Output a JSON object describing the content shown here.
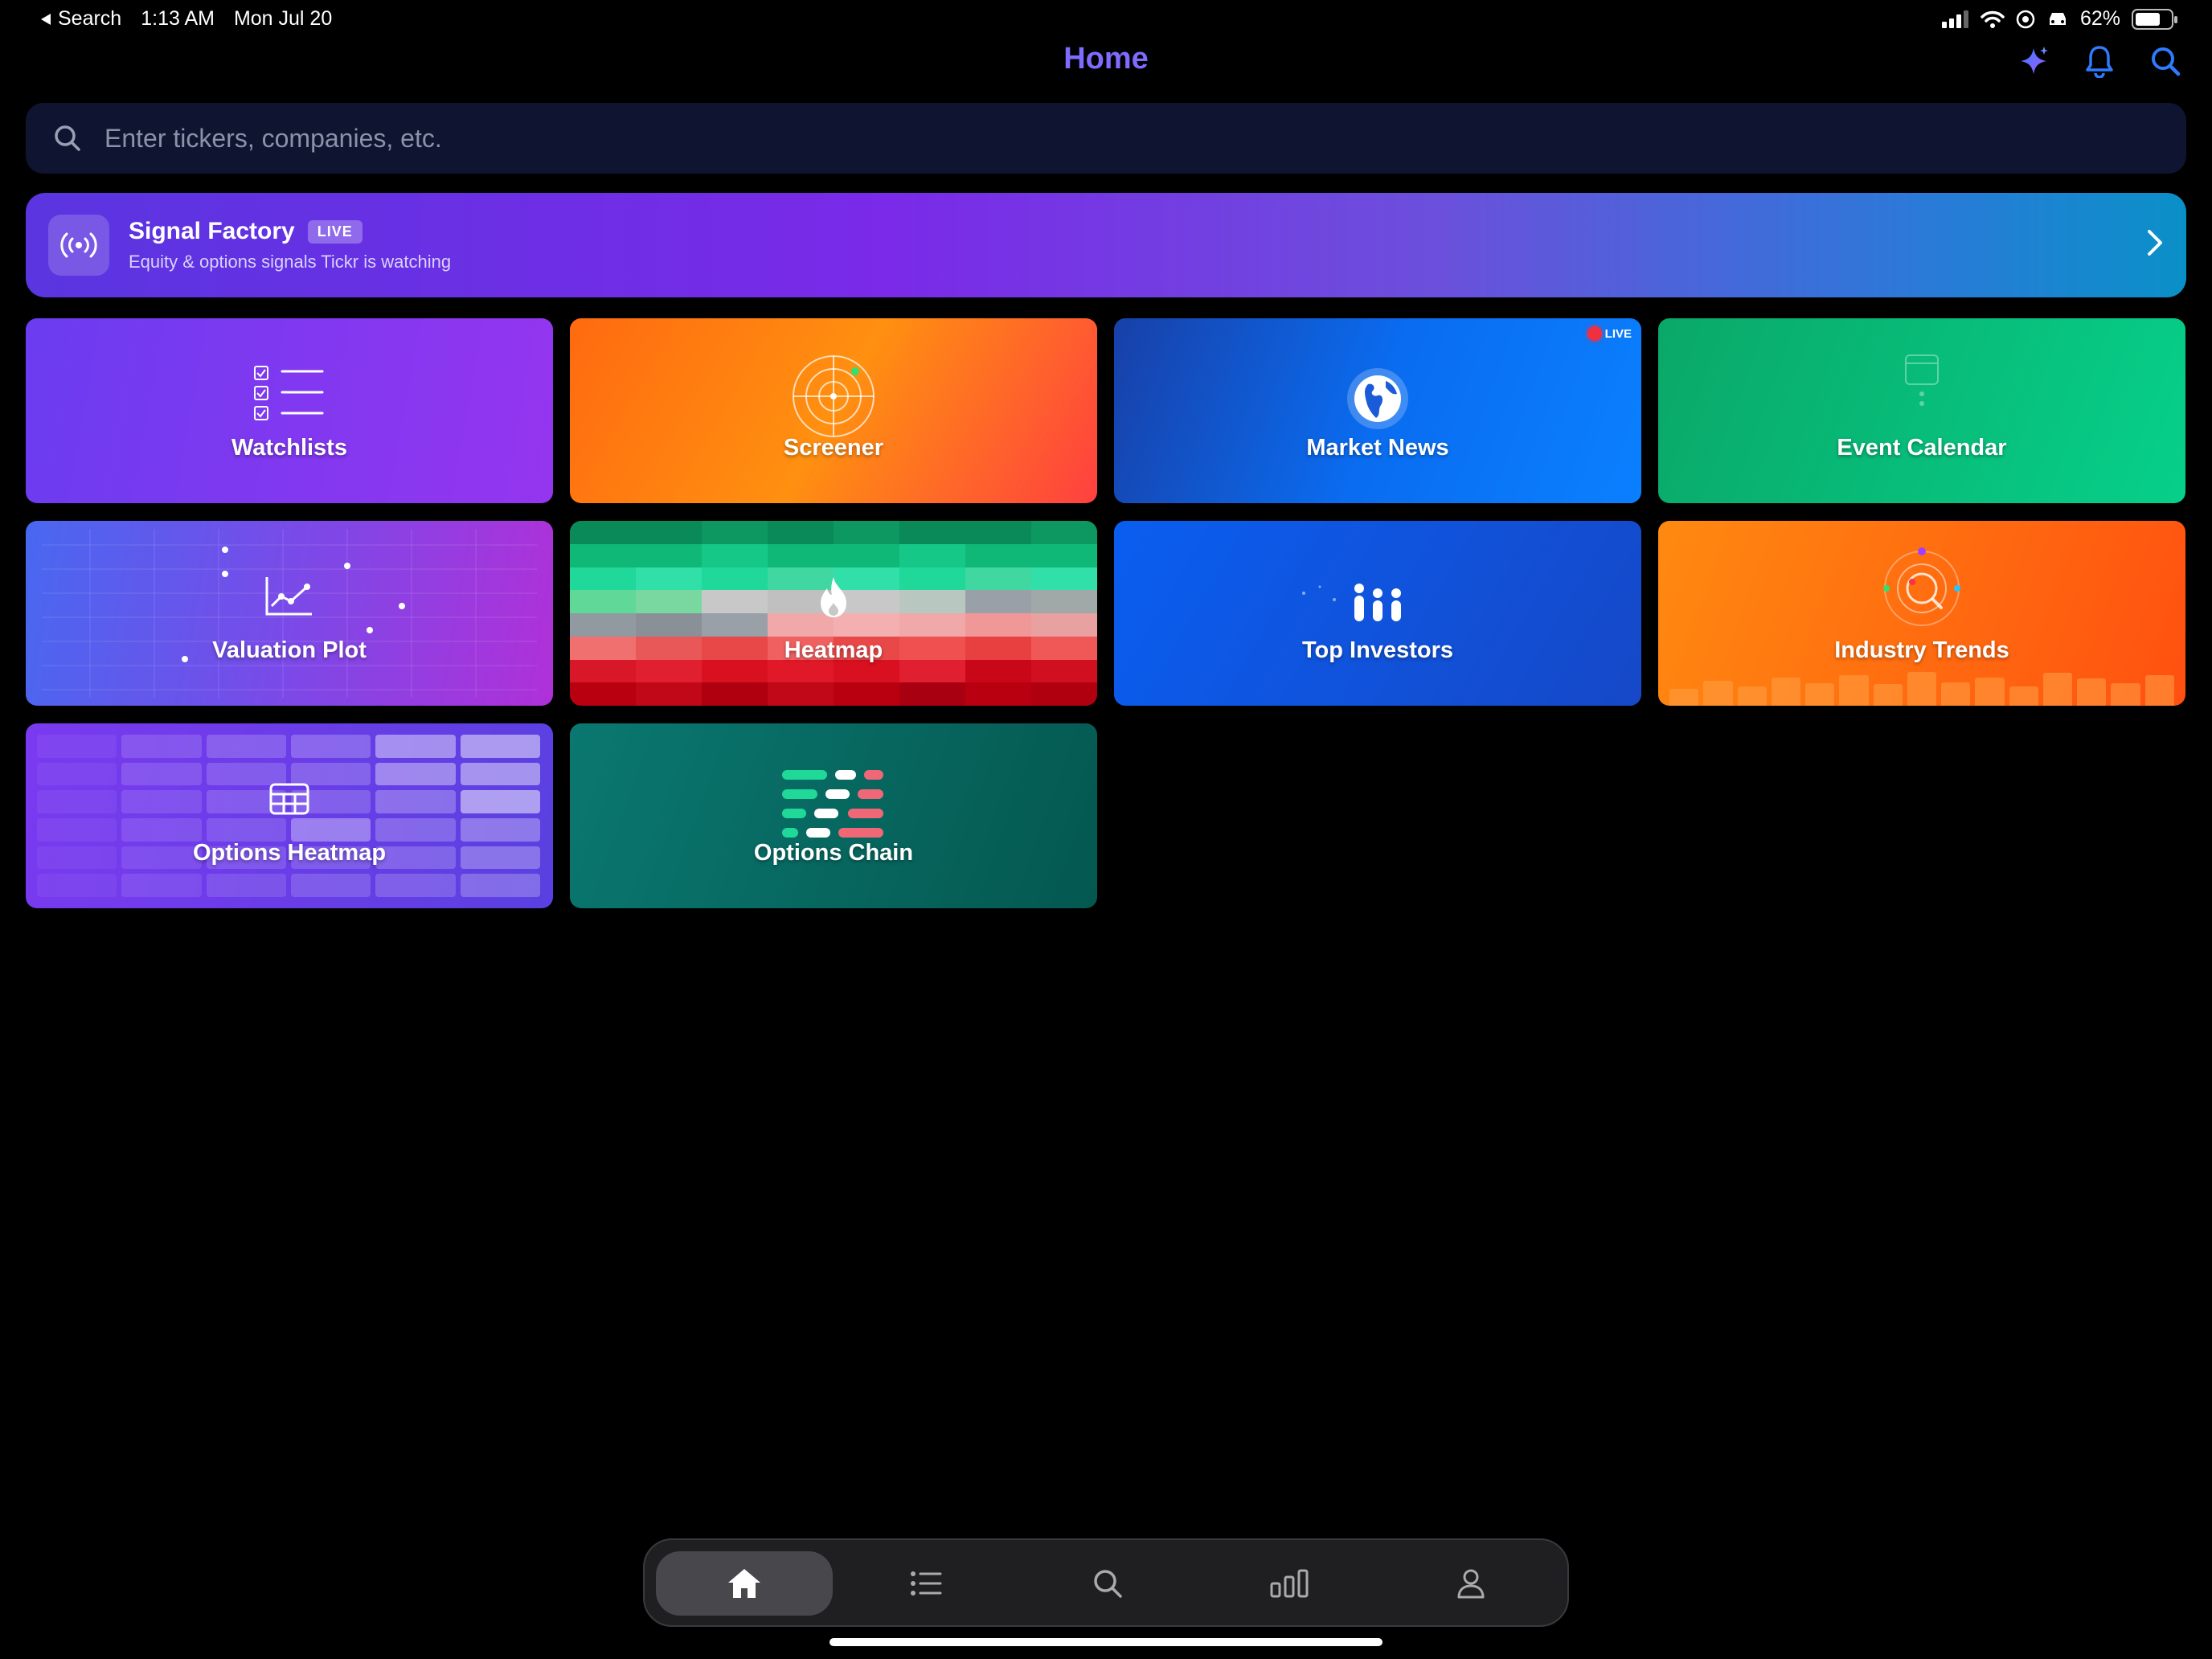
{
  "status_bar": {
    "back_label": "Search",
    "time": "1:13 AM",
    "date": "Mon Jul 20",
    "battery": "62%"
  },
  "header": {
    "title": "Home",
    "icons": [
      "sparkle-icon",
      "bell-icon",
      "search-icon"
    ]
  },
  "search": {
    "placeholder": "Enter tickers, companies, etc."
  },
  "banner": {
    "title": "Signal Factory",
    "badge": "LIVE",
    "subtitle": "Equity & options signals Tickr is watching"
  },
  "tiles": {
    "watchlists": "Watchlists",
    "screener": "Screener",
    "market_news": "Market News",
    "market_news_badge": "LIVE",
    "event_calendar": "Event Calendar",
    "valuation_plot": "Valuation Plot",
    "heatmap": "Heatmap",
    "top_investors": "Top Investors",
    "industry_trends": "Industry Trends",
    "options_heatmap": "Options Heatmap",
    "options_chain": "Options Chain"
  },
  "tab_bar": {
    "items": [
      "home-icon",
      "list-icon",
      "search-icon",
      "bar-chart-icon",
      "profile-icon"
    ],
    "active": 0
  },
  "colors": {
    "accent": "#2f7bff",
    "title_gradient_start": "#5b7cff",
    "title_gradient_end": "#a15bff"
  }
}
